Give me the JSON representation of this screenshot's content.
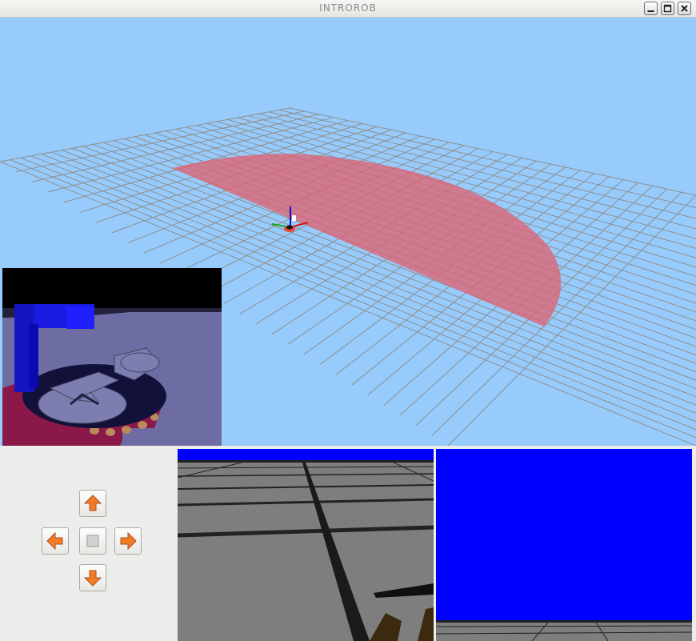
{
  "window": {
    "title": "INTROROB",
    "buttons": [
      "minimize",
      "maximize",
      "close"
    ]
  },
  "icons": {
    "minimize": "minimize-icon",
    "maximize": "maximize-icon",
    "close": "close-icon",
    "forward": "arrow-up-icon",
    "left": "arrow-left-icon",
    "stop": "stop-icon",
    "right": "arrow-right-icon",
    "backward": "arrow-down-icon"
  },
  "colors": {
    "sky": "#97cbfb",
    "grid": "#8f8f8f",
    "laser_range": "#e0606f",
    "arrow": "#f07c28",
    "camera_background": "#0000ff",
    "floor": "#7e7e7e"
  },
  "controls": {
    "forward": "forward",
    "left": "turn-left",
    "stop": "stop",
    "right": "turn-right",
    "backward": "backward"
  }
}
